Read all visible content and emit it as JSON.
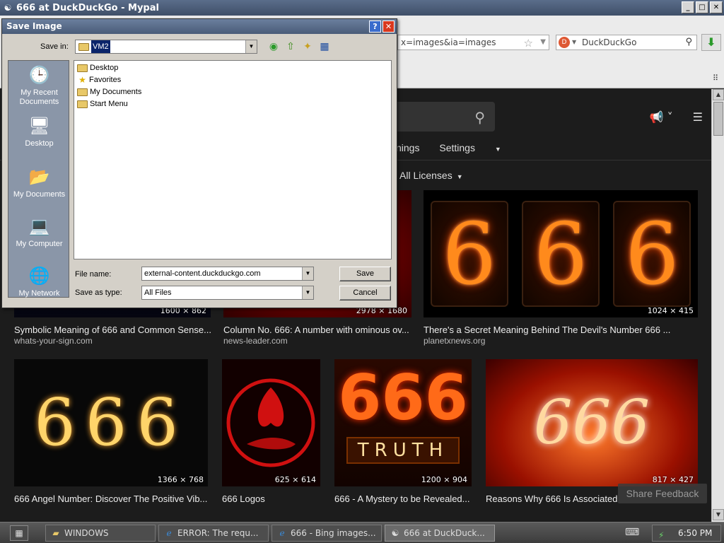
{
  "browser": {
    "title": "666 at DuckDuckGo - Mypal",
    "url_fragment": "x=images&ia=images",
    "search_engine": "DuckDuckGo"
  },
  "page": {
    "nav": [
      "nings",
      "Settings"
    ],
    "license_filter": "All Licenses",
    "feedback": "Share Feedback",
    "row1": [
      {
        "dims": "1600 × 862",
        "title": "Symbolic Meaning of 666 and Common Sense...",
        "source": "whats-your-sign.com"
      },
      {
        "dims": "2978 × 1680",
        "title": "Column No. 666: A number with ominous ov...",
        "source": "news-leader.com"
      },
      {
        "dims": "1024 × 415",
        "title": "There's a Secret Meaning Behind The Devil's Number 666 ...",
        "source": "planetxnews.org"
      }
    ],
    "row2": [
      {
        "dims": "1366 × 768",
        "title": "666 Angel Number: Discover The Positive Vib..."
      },
      {
        "dims": "625 × 614",
        "title": "666 Logos"
      },
      {
        "dims": "1200 × 904",
        "title": "666 - A Mystery to be Revealed..."
      },
      {
        "dims": "817 × 427",
        "title": "Reasons Why 666 Is Associated w"
      }
    ],
    "nixie_digits": [
      "6",
      "6",
      "6"
    ],
    "sparkler_text": "666",
    "truth_nums": "666",
    "truth_word": "TRUTH",
    "fire_text": "666"
  },
  "dialog": {
    "title": "Save Image",
    "save_in_label": "Save in:",
    "save_in_value": "VM2",
    "places": [
      "My Recent Documents",
      "Desktop",
      "My Documents",
      "My Computer",
      "My Network"
    ],
    "files": [
      "Desktop",
      "Favorites",
      "My Documents",
      "Start Menu"
    ],
    "file_name_label": "File name:",
    "file_name_value": "external-content.duckduckgo.com",
    "save_type_label": "Save as type:",
    "save_type_value": "All Files",
    "save_btn": "Save",
    "cancel_btn": "Cancel"
  },
  "taskbar": {
    "tasks": [
      "WINDOWS",
      "ERROR: The requ...",
      "666 - Bing images...",
      "666 at DuckDuck..."
    ],
    "clock": "6:50 PM"
  }
}
